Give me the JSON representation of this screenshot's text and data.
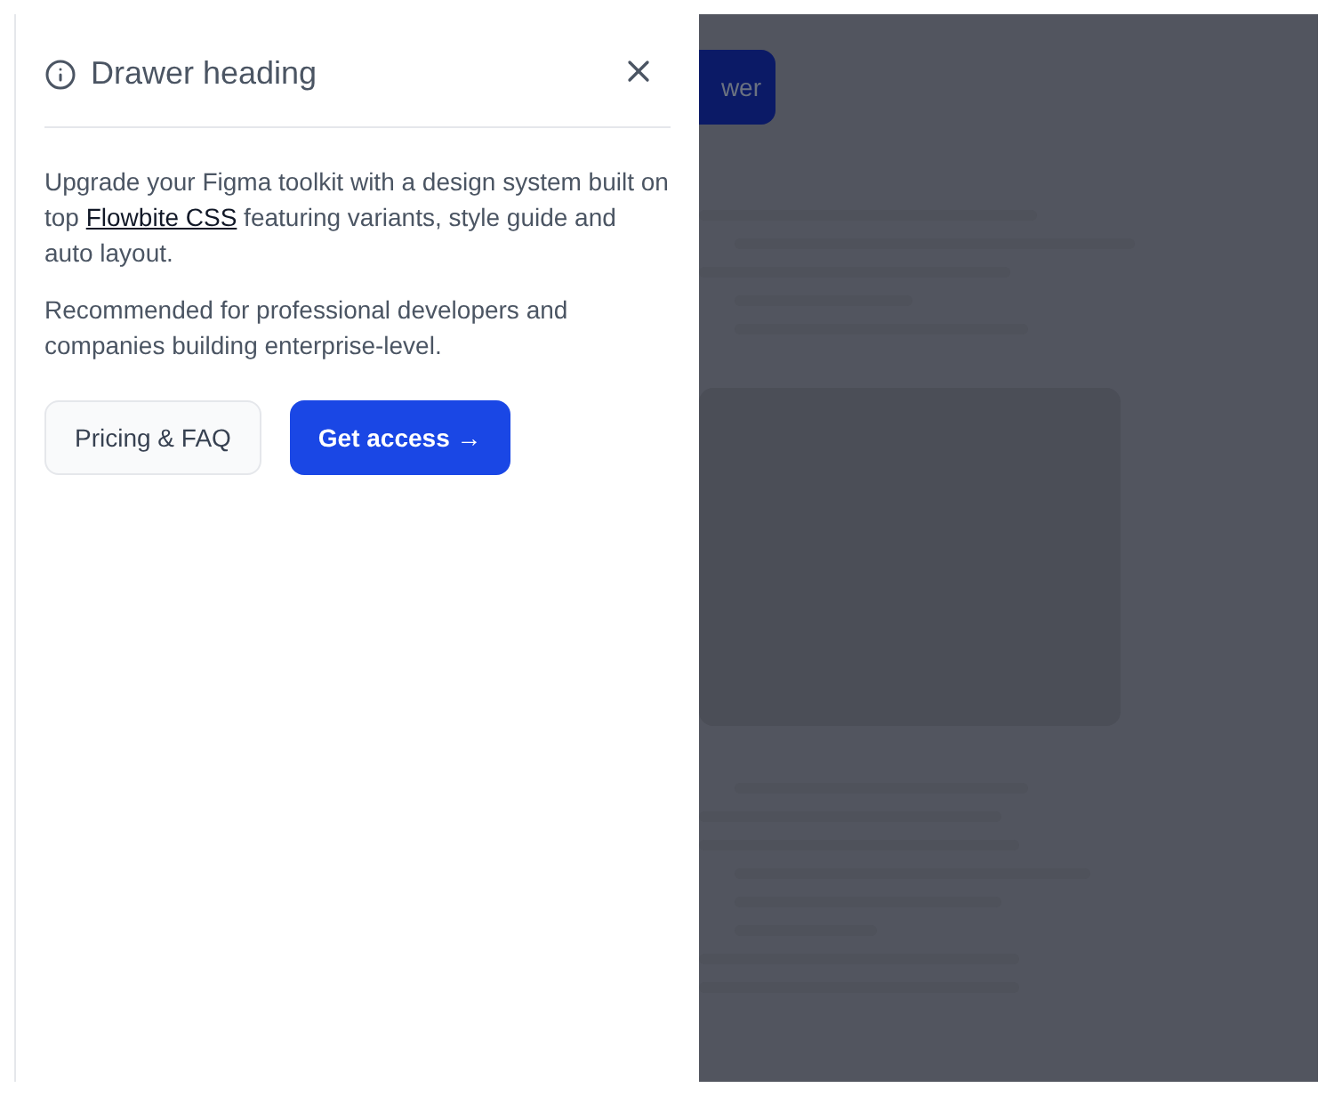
{
  "drawer": {
    "title": "Drawer heading",
    "paragraph_1": {
      "before": "Upgrade your Figma toolkit with a design system built on top ",
      "link": "Flowbite CSS",
      "after": " featuring variants, style guide and auto layout."
    },
    "paragraph_2": "Recommended for professional developers and companies building enterprise-level.",
    "buttons": [
      {
        "kind": "secondary",
        "label": "Pricing & FAQ"
      },
      {
        "kind": "primary",
        "label": "Get access",
        "arrow": "→"
      }
    ]
  },
  "background": {
    "button_label": "wer"
  }
}
